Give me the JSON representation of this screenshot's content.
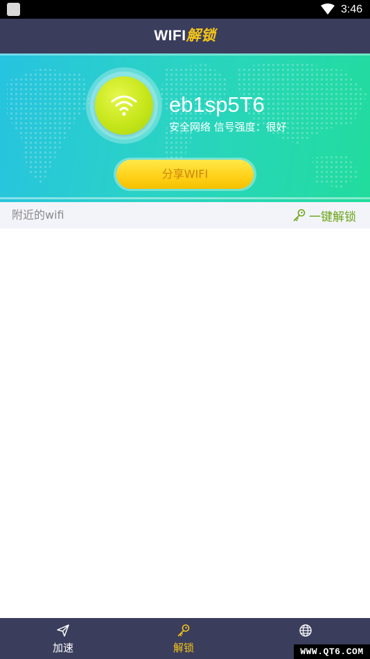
{
  "status_bar": {
    "time": "3:46"
  },
  "header": {
    "title_part1": "WIFI",
    "title_part2": "解锁"
  },
  "hero": {
    "ssid": "eb1sp5T6",
    "status_text": "安全网络 信号强度：很好",
    "share_button_label": "分享WIFI"
  },
  "nearby": {
    "label": "附近的wifi",
    "unlock_all_label": "一键解锁"
  },
  "bottom_nav": {
    "items": [
      {
        "label": "加速",
        "icon": "paper-plane-icon",
        "active": false
      },
      {
        "label": "解锁",
        "icon": "key-icon",
        "active": true
      },
      {
        "label": "",
        "icon": "globe-icon",
        "active": false
      }
    ]
  },
  "watermark": {
    "text": "WWW.QT6.COM"
  },
  "colors": {
    "header_bg": "#3a3d5c",
    "accent_yellow": "#f5c518",
    "accent_green": "#6aa516",
    "hero_start": "#27c3e0",
    "hero_end": "#22dc9d"
  }
}
